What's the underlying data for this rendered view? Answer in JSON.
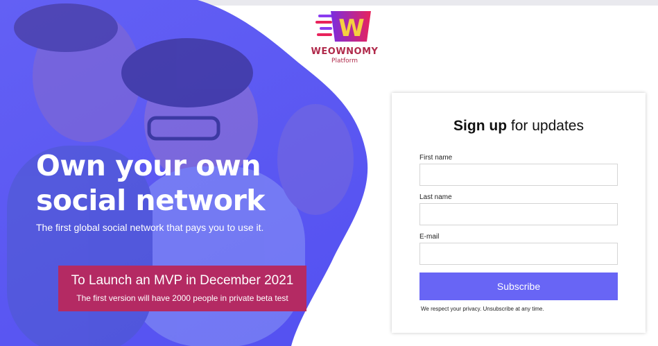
{
  "brand": {
    "logo_letter": "W",
    "name": "WEOWNOMY",
    "tagline": "Platform",
    "colors": {
      "gradient_start": "#7a2ce0",
      "gradient_end": "#e8235c",
      "letter": "#f5d040",
      "text": "#b02a4b"
    }
  },
  "hero": {
    "title_line1": "Own your own",
    "title_line2": "social network",
    "subtitle": "The first global social network that pays you to use it.",
    "overlay_color": "#5b58f2"
  },
  "launch_banner": {
    "title": "To Launch an MVP in December 2021",
    "subtitle": "The first version will have 2000 people in private beta test",
    "color": "#b42a63"
  },
  "signup": {
    "heading_bold": "Sign up",
    "heading_rest": " for updates",
    "first_name": {
      "label": "First name",
      "value": "",
      "placeholder": ""
    },
    "last_name": {
      "label": "Last name",
      "value": "",
      "placeholder": ""
    },
    "email": {
      "label": "E-mail",
      "value": "",
      "placeholder": ""
    },
    "subscribe_label": "Subscribe",
    "privacy_note": "We respect your privacy. Unsubscribe at any time.",
    "button_color": "#6865f5"
  }
}
